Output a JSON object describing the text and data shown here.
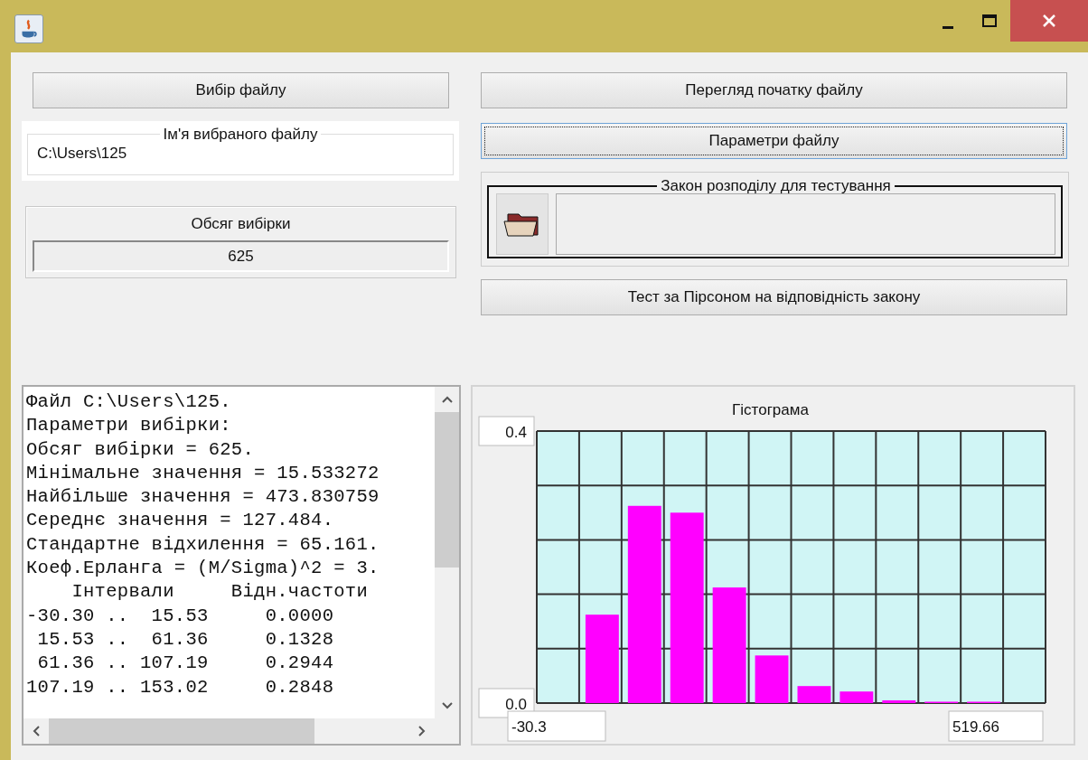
{
  "choose_file_button": "Вибір файлу",
  "file_name_group": {
    "legend": "Ім'я вибраного файлу",
    "value": "C:\\Users\\125"
  },
  "sample_size_group": {
    "label": "Обсяг вибірки",
    "value": "625"
  },
  "preview_button": "Перегляд початку файлу",
  "params_button": {
    "label": "Параметри файлу",
    "focused": true
  },
  "law_group": {
    "legend": "Закон розподілу для тестування"
  },
  "pearson_button": "Тест за Пірсоном на відповідність закону",
  "output_lines": [
    "Файл C:\\Users\\125.",
    "Параметри вибірки:",
    "Обсяг вибірки = 625.",
    "Мінімальне значення = 15.533272",
    "Найбільше значення = 473.830759",
    "Середнє значення = 127.484.",
    "Стандартне відхилення = 65.161.",
    "Коеф.Ерланга = (M/Sigma)^2 = 3.",
    "    Інтервали     Відн.частоти",
    "-30.30 ..  15.53     0.0000",
    " 15.53 ..  61.36     0.1328",
    " 61.36 .. 107.19     0.2944",
    "107.19 .. 153.02     0.2848"
  ],
  "histogram": {
    "chart_data": {
      "type": "bar",
      "title": "Гістограма",
      "series": [
        {
          "color": "#ff00ff",
          "values": [
            0,
            0.13,
            0.29,
            0.28,
            0.17,
            0.07,
            0.025,
            0.017,
            0.004,
            0.002,
            0.002,
            0
          ]
        }
      ],
      "ylim": [
        0,
        0.4
      ],
      "yticks": [
        {
          "value": 0,
          "label": "0.0"
        },
        {
          "value": 0.4,
          "label": "0.4"
        }
      ]
    },
    "x_min_label": "-30.3",
    "x_max_label": "519.66"
  }
}
